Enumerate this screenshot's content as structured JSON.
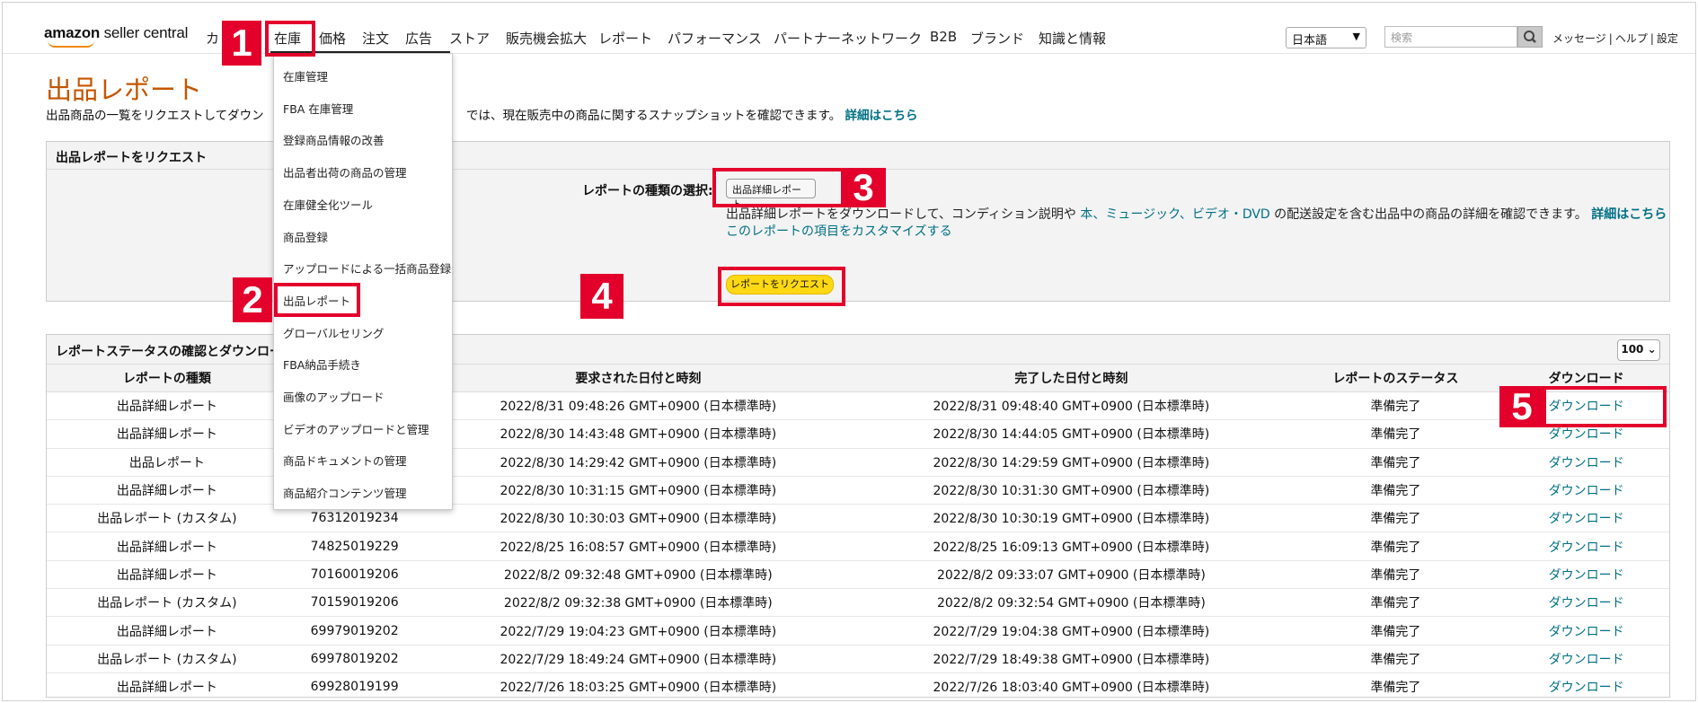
{
  "brand": {
    "name_bold": "amazon",
    "name_rest": " seller central"
  },
  "nav": {
    "items": [
      "カ",
      "在庫",
      "価格",
      "注文",
      "広告",
      "ストア",
      "販売機会拡大",
      "レポート",
      "パフォーマンス",
      "パートナーネットワーク",
      "B2B",
      "ブランド",
      "知識と情報"
    ]
  },
  "topbar": {
    "language": "日本語",
    "search_placeholder": "検索",
    "links": [
      "メッセージ",
      "ヘルプ",
      "設定"
    ]
  },
  "page": {
    "title": "出品レポート",
    "desc_part1": "出品商品の一覧をリクエストしてダウン",
    "desc_part2": "では、現在販売中の商品に関するスナップショットを確認できます。",
    "desc_link": "詳細はこちら"
  },
  "request_panel": {
    "header": "出品レポートをリクエスト",
    "select_label": "レポートの種類の選択:",
    "select_value": "出品詳細レポート",
    "desc_line1_a": "出品詳細レポートをダウンロードして、コンディション説明や ",
    "desc_line1_link": "本、ミュージック、ビデオ・DVD",
    "desc_line1_b": " の配送設定を含む出品中の商品の詳細を確認できます。",
    "desc_line1_more": "詳細はこちら",
    "desc_line2": "このレポートの項目をカスタマイズする",
    "button": "レポートをリクエスト"
  },
  "status_panel": {
    "header": "レポートステータスの確認とダウンロー",
    "per_page": "100",
    "columns": [
      "レポートの種類",
      "",
      "要求された日付と時刻",
      "完了した日付と時刻",
      "レポートのステータス",
      "ダウンロード"
    ],
    "rows": [
      [
        "出品詳細レポート",
        "",
        "2022/8/31 09:48:26 GMT+0900 (日本標準時)",
        "2022/8/31 09:48:40 GMT+0900 (日本標準時)",
        "準備完了",
        "ダウンロード"
      ],
      [
        "出品詳細レポート",
        "",
        "2022/8/30 14:43:48 GMT+0900 (日本標準時)",
        "2022/8/30 14:44:05 GMT+0900 (日本標準時)",
        "準備完了",
        "ダウンロード"
      ],
      [
        "出品レポート",
        "",
        "2022/8/30 14:29:42 GMT+0900 (日本標準時)",
        "2022/8/30 14:29:59 GMT+0900 (日本標準時)",
        "準備完了",
        "ダウンロード"
      ],
      [
        "出品詳細レポート",
        "",
        "2022/8/30 10:31:15 GMT+0900 (日本標準時)",
        "2022/8/30 10:31:30 GMT+0900 (日本標準時)",
        "準備完了",
        "ダウンロード"
      ],
      [
        "出品レポート (カスタム)",
        "76312019234",
        "2022/8/30 10:30:03 GMT+0900 (日本標準時)",
        "2022/8/30 10:30:19 GMT+0900 (日本標準時)",
        "準備完了",
        "ダウンロード"
      ],
      [
        "出品詳細レポート",
        "74825019229",
        "2022/8/25 16:08:57 GMT+0900 (日本標準時)",
        "2022/8/25 16:09:13 GMT+0900 (日本標準時)",
        "準備完了",
        "ダウンロード"
      ],
      [
        "出品詳細レポート",
        "70160019206",
        "2022/8/2 09:32:48 GMT+0900 (日本標準時)",
        "2022/8/2 09:33:07 GMT+0900 (日本標準時)",
        "準備完了",
        "ダウンロード"
      ],
      [
        "出品レポート (カスタム)",
        "70159019206",
        "2022/8/2 09:32:38 GMT+0900 (日本標準時)",
        "2022/8/2 09:32:54 GMT+0900 (日本標準時)",
        "準備完了",
        "ダウンロード"
      ],
      [
        "出品詳細レポート",
        "69979019202",
        "2022/7/29 19:04:23 GMT+0900 (日本標準時)",
        "2022/7/29 19:04:38 GMT+0900 (日本標準時)",
        "準備完了",
        "ダウンロード"
      ],
      [
        "出品レポート (カスタム)",
        "69978019202",
        "2022/7/29 18:49:24 GMT+0900 (日本標準時)",
        "2022/7/29 18:49:38 GMT+0900 (日本標準時)",
        "準備完了",
        "ダウンロード"
      ],
      [
        "出品詳細レポート",
        "69928019199",
        "2022/7/26 18:03:25 GMT+0900 (日本標準時)",
        "2022/7/26 18:03:40 GMT+0900 (日本標準時)",
        "準備完了",
        "ダウンロード"
      ]
    ]
  },
  "inventory_menu": {
    "items": [
      "在庫管理",
      "FBA 在庫管理",
      "登録商品情報の改善",
      "出品者出荷の商品の管理",
      "在庫健全化ツール",
      "商品登録",
      "アップロードによる一括商品登録",
      "出品レポート",
      "グローバルセリング",
      "FBA納品手続き",
      "画像のアップロード",
      "ビデオのアップロードと管理",
      "商品ドキュメントの管理",
      "商品紹介コンテンツ管理"
    ]
  },
  "callouts": [
    "1",
    "2",
    "3",
    "4",
    "5"
  ],
  "colors": {
    "accent_title": "#c45500",
    "link": "#007185",
    "callout": "#e3002b",
    "button": "#ffd814"
  }
}
